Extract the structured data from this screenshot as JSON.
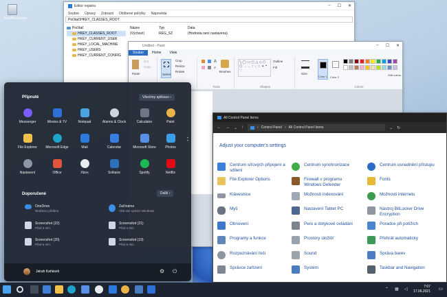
{
  "desktop": {
    "recycle_label": "Koš/Recyklace"
  },
  "regedit": {
    "title": "Editor registru",
    "menu": [
      "Soubor",
      "Úpravy",
      "Zobrazit",
      "Oblíbené položky",
      "Nápověda"
    ],
    "path": "Počítač\\HKEY_CLASSES_ROOT",
    "tree": [
      "Počítač",
      "HKEY_CLASSES_ROOT",
      "HKEY_CURRENT_USER",
      "HKEY_LOCAL_MACHINE",
      "HKEY_USERS",
      "HKEY_CURRENT_CONFIG"
    ],
    "columns": [
      "Název",
      "Typ",
      "Data"
    ],
    "row": [
      "(Výchozí)",
      "REG_SZ",
      "(Hodnota není nastavena)"
    ]
  },
  "paint": {
    "title": "Untitled - Paint",
    "tabs": [
      "Soubor",
      "Home",
      "View"
    ],
    "groups": {
      "clipboard": "Clipboard",
      "paste": "Paste",
      "cut": "Cut",
      "copy": "Copy",
      "image": "Image",
      "select": "Select",
      "crop": "Crop",
      "resize": "Resize",
      "rotate": "Rotate",
      "tools": "Tools",
      "brushes": "Brushes",
      "shapes": "Shapes",
      "outline": "Outline",
      "fill": "Fill",
      "size": "Size",
      "color1": "Color 1",
      "color2": "Color 2",
      "colors": "Colors",
      "edit_colors": "Edit colors"
    },
    "palette": [
      "#000000",
      "#7f7f7f",
      "#880015",
      "#ed1c24",
      "#ff7f27",
      "#fff200",
      "#22b14c",
      "#00a2e8",
      "#3f48cc",
      "#a349a4",
      "#ffffff",
      "#c3c3c3",
      "#b97a57",
      "#ffaec9",
      "#ffc90e",
      "#efe4b0",
      "#b5e61d",
      "#99d9ea",
      "#7092be",
      "#c8bfe7"
    ]
  },
  "control_panel": {
    "title": "All Control Panel Items",
    "breadcrumb": [
      "Control Panel",
      "All Control Panel Items"
    ],
    "heading": "Adjust your computer's settings",
    "items": [
      [
        "Centrum síťových připojení a sdílení",
        "Centrum synchronizace",
        "Centrum usnadnění přístupu"
      ],
      [
        "File Explorer Options",
        "Firewall v programu Windows Defender",
        "Fonts"
      ],
      [
        "Klávesnice",
        "Možnosti indexování",
        "Možnosti internetu"
      ],
      [
        "Myš",
        "Nastavení Tablet PC",
        "Nástroj BitLocker Drive Encryption"
      ],
      [
        "Obnovení",
        "Pero a dotykové ovládání",
        "Poradce při potížích"
      ],
      [
        "Programy a funkce",
        "Prostory úložišť",
        "Přehrát automaticky"
      ],
      [
        "Rozpoznávání řeči",
        "Sound",
        "Správa barev"
      ],
      [
        "Správce zařízení",
        "Systém",
        "Taskbar and Navigation"
      ]
    ]
  },
  "start_menu": {
    "pinned_title": "Připnuté",
    "all_apps": "Všechny aplikace  ›",
    "apps": [
      "Messenger",
      "Movies & TV",
      "Notepad",
      "Alarms & Clock",
      "Calculator",
      "Paint",
      "File Explorer",
      "Microsoft Edge",
      "Mail",
      "Calendar",
      "Microsoft Store",
      "Photos",
      "Nastavení",
      "Office",
      "Xbox",
      "Solitaire",
      "Spotify",
      "Netflix"
    ],
    "recommended_title": "Doporučené",
    "more": "Další  ›",
    "recommended": [
      {
        "name": "OneDrive",
        "sub": "Nedávno přidáno"
      },
      {
        "name": "Začínáme",
        "sub": "Vítá vás systém Windows"
      },
      {
        "name": "Screenshot (22)",
        "sub": "Před 4 min"
      },
      {
        "name": "Screenshot (21)",
        "sub": "Před 4 min"
      },
      {
        "name": "Screenshot (20)",
        "sub": "Před 5 min"
      },
      {
        "name": "Screenshot (19)",
        "sub": "Před 5 min"
      }
    ],
    "user": "Jakub Kaňásek"
  },
  "taskbar": {
    "time": "7:07",
    "date": "17.06.2021"
  }
}
